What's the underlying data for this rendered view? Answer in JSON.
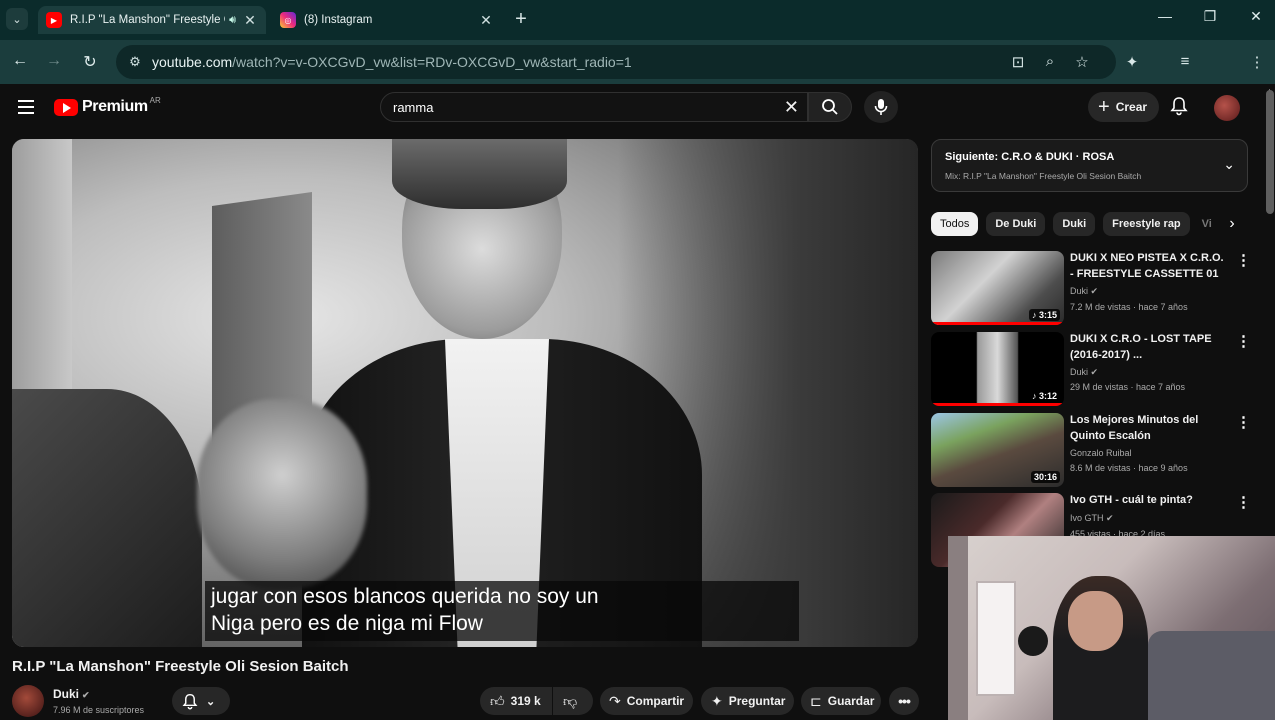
{
  "browser": {
    "tabs": [
      {
        "title": "R.I.P \"La Manshon\" Freestyle O",
        "favicon": "youtube-icon",
        "active": true
      },
      {
        "title": "(8) Instagram",
        "favicon": "instagram-icon",
        "active": false
      }
    ],
    "url_main": "youtube.com",
    "url_rest": "/watch?v=v-OXCGvD_vw&list=RDv-OXCGvD_vw&start_radio=1"
  },
  "youtube": {
    "logo_word": "Premium",
    "logo_region": "AR",
    "search_value": "ramma",
    "create_label": "Crear"
  },
  "video": {
    "caption_line1": "jugar con esos blancos querida no soy un",
    "caption_line2": "Niga pero es de niga mi Flow",
    "title": "R.I.P \"La Manshon\" Freestyle Oli Sesion Baitch",
    "channel": "Duki",
    "subscribers": "7.96 M de suscriptores",
    "likes": "319 k",
    "share_label": "Compartir",
    "ask_label": "Preguntar",
    "save_label": "Guardar"
  },
  "sidebar": {
    "up_next": "Siguiente: C.R.O & DUKI · ROSA",
    "mix": "Mix: R.I.P \"La Manshon\" Freestyle Oli Sesion Baitch",
    "chips": [
      "Todos",
      "De Duki",
      "Duki",
      "Freestyle rap",
      "Vi"
    ],
    "recommendations": [
      {
        "title": "DUKI X NEO PISTEA X C.R.O. - FREESTYLE CASSETTE 01",
        "channel": "Duki",
        "meta": "7.2 M de vistas · hace 7 años",
        "duration": "3:15",
        "progress": 1.0
      },
      {
        "title": "DUKI X C.R.O - LOST TAPE (2016-2017) ...",
        "channel": "Duki",
        "meta": "29 M de vistas · hace 7 años",
        "duration": "3:12",
        "progress": 1.0
      },
      {
        "title": "Los Mejores Minutos del Quinto Escalón",
        "channel": "Gonzalo Ruibal",
        "meta": "8.6 M de vistas · hace 9 años",
        "duration": "30:16",
        "progress": 0.0
      },
      {
        "title": "Ivo GTH - cuál te pinta?",
        "channel": "Ivo GTH",
        "meta": "455 vistas · hace 2 días",
        "duration": "",
        "progress": 0.0
      }
    ]
  },
  "colors": {
    "accent": "#ff0000",
    "chrome_tab_bg": "#0b2b2b",
    "chrome_toolbar_bg": "#1b3d3d",
    "yt_bg": "#0f0f0f"
  }
}
